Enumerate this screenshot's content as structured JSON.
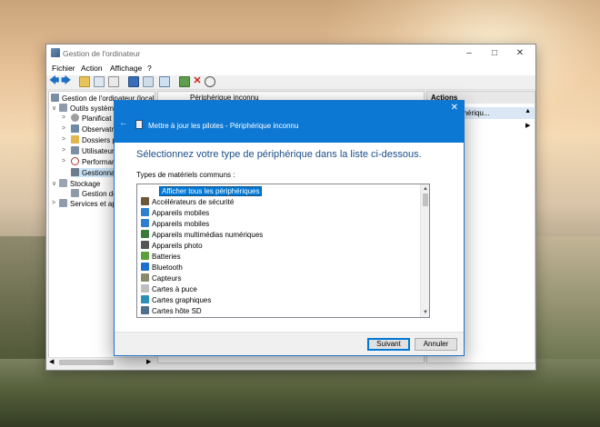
{
  "cm": {
    "title": "Gestion de l'ordinateur",
    "menu": [
      "Fichier",
      "Action",
      "Affichage",
      "?"
    ],
    "tree": {
      "root": "Gestion de l'ordinateur (local)",
      "system_tools": "Outils système",
      "task_scheduler": "Planificat",
      "event_viewer": "Observatr",
      "shared_folders": "Dossiers pa",
      "local_users": "Utilisateurs",
      "performance": "Performan",
      "device_manager": "Gestionnai",
      "storage": "Stockage",
      "disk_management": "Gestion de",
      "services": "Services et app"
    },
    "middle_header": "Périphérique inconnu",
    "actions": {
      "header": "Actions",
      "selected": "e de périphériqu...",
      "sub": "actions"
    }
  },
  "dialog": {
    "title": "Mettre à jour les pilotes - Périphérique inconnu",
    "heading": "Sélectionnez votre type de périphérique dans la liste ci-dessous.",
    "label": "Types de matériels communs :",
    "items": [
      {
        "label": "Afficher tous les périphériques",
        "icon": "none",
        "color": "#ffffff"
      },
      {
        "label": "Accélérateurs de sécurité",
        "icon": "security-accelerator-icon",
        "color": "#6b5a3a"
      },
      {
        "label": "Appareils mobiles",
        "icon": "mobile-device-icon",
        "color": "#2f7fd1"
      },
      {
        "label": "Appareils mobiles",
        "icon": "mobile-device-icon",
        "color": "#2f7fd1"
      },
      {
        "label": "Appareils multimédias numériques",
        "icon": "media-device-icon",
        "color": "#3a7a3a"
      },
      {
        "label": "Appareils photo",
        "icon": "camera-icon",
        "color": "#555555"
      },
      {
        "label": "Batteries",
        "icon": "battery-icon",
        "color": "#5aa03c"
      },
      {
        "label": "Bluetooth",
        "icon": "bluetooth-icon",
        "color": "#1a6fd0"
      },
      {
        "label": "Capteurs",
        "icon": "sensor-icon",
        "color": "#8a8a6a"
      },
      {
        "label": "Cartes à puce",
        "icon": "smart-card-icon",
        "color": "#bfbfbf"
      },
      {
        "label": "Cartes graphiques",
        "icon": "display-adapter-icon",
        "color": "#2d8fb3"
      },
      {
        "label": "Cartes hôte SD",
        "icon": "sd-host-icon",
        "color": "#4f6f8f"
      }
    ],
    "next_label": "Suivant",
    "cancel_label": "Annuler"
  }
}
